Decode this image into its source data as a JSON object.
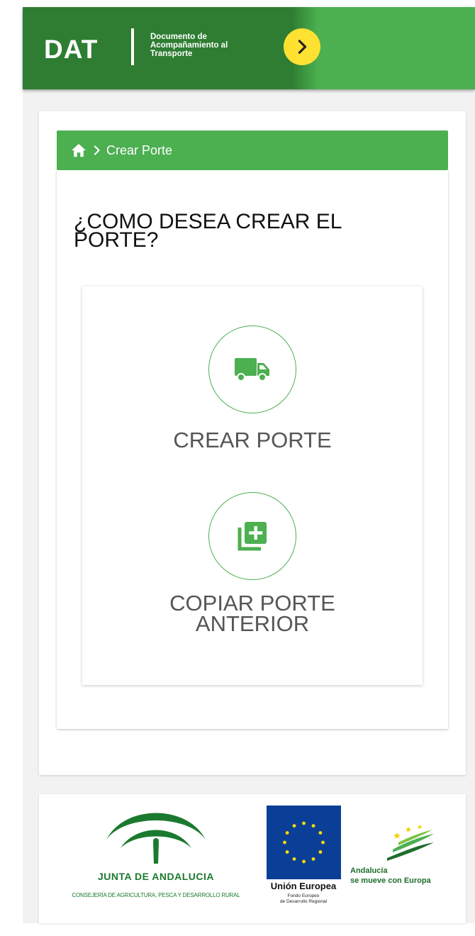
{
  "header": {
    "logo_text": "DAT",
    "logo_subtitle_1": "Documento de",
    "logo_subtitle_2": "Acompañamiento al",
    "logo_subtitle_3": "Transporte",
    "menu_icon": "chevron-right-icon"
  },
  "breadcrumb": {
    "home_icon": "home-icon",
    "current": "Crear Porte"
  },
  "main": {
    "question_line1": "¿COMO DESEA CREAR EL",
    "question_line2": "PORTE?",
    "options": [
      {
        "icon": "truck-icon",
        "label": "CREAR PORTE"
      },
      {
        "icon": "copy-add-icon",
        "label_line1": "COPIAR PORTE",
        "label_line2": "ANTERIOR"
      }
    ]
  },
  "footer": {
    "junta_name": "JUNTA DE ANDALUCIA",
    "junta_department": "CONSEJERÍA DE AGRICULTURA, PESCA Y DESARROLLO RURAL",
    "eu_name": "Unión Europea",
    "eu_fund_line1": "Fondo Europeo",
    "eu_fund_line2": "de Desarrollo Regional",
    "andalucia_line1": "Andalucía",
    "andalucia_line2": "se mueve con Europa"
  },
  "colors": {
    "primary_green": "#4caf50",
    "dark_green": "#2e7d32",
    "accent_yellow": "#ffe132",
    "eu_blue": "#0b3f97"
  }
}
